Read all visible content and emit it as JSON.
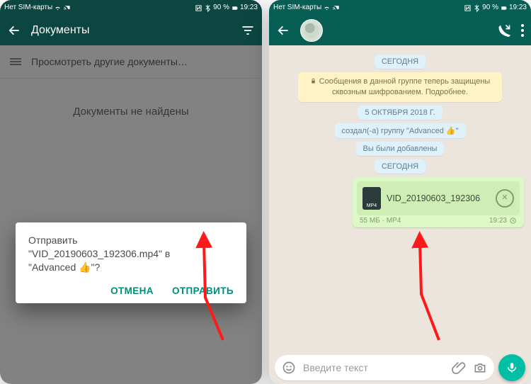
{
  "status": {
    "sim": "Нет SIM-карты",
    "battery": "90 %",
    "time": "19:23"
  },
  "left": {
    "title": "Документы",
    "browse": "Просмотреть другие документы…",
    "empty": "Документы не найдены",
    "dialog": {
      "l1": "Отправить",
      "l2": "\"VID_20190603_192306.mp4\" в",
      "l3": "\"Advanced 👍\"?",
      "cancel": "ОТМЕНА",
      "send": "ОТПРАВИТЬ"
    }
  },
  "right": {
    "chips": {
      "today": "СЕГОДНЯ",
      "enc": "Сообщения в данной группе теперь защищены сквозным шифрованием. Подробнее.",
      "date": "5 ОКТЯБРЯ 2018 Г.",
      "created": "создал(-а) группу \"Advanced 👍\"",
      "added": "Вы были добавлены"
    },
    "doc": {
      "name": "VID_20190603_192306",
      "badge": "MP4",
      "size": "55 МБ",
      "type": "MP4",
      "time": "19:23"
    },
    "input": {
      "placeholder": "Введите текст"
    }
  }
}
